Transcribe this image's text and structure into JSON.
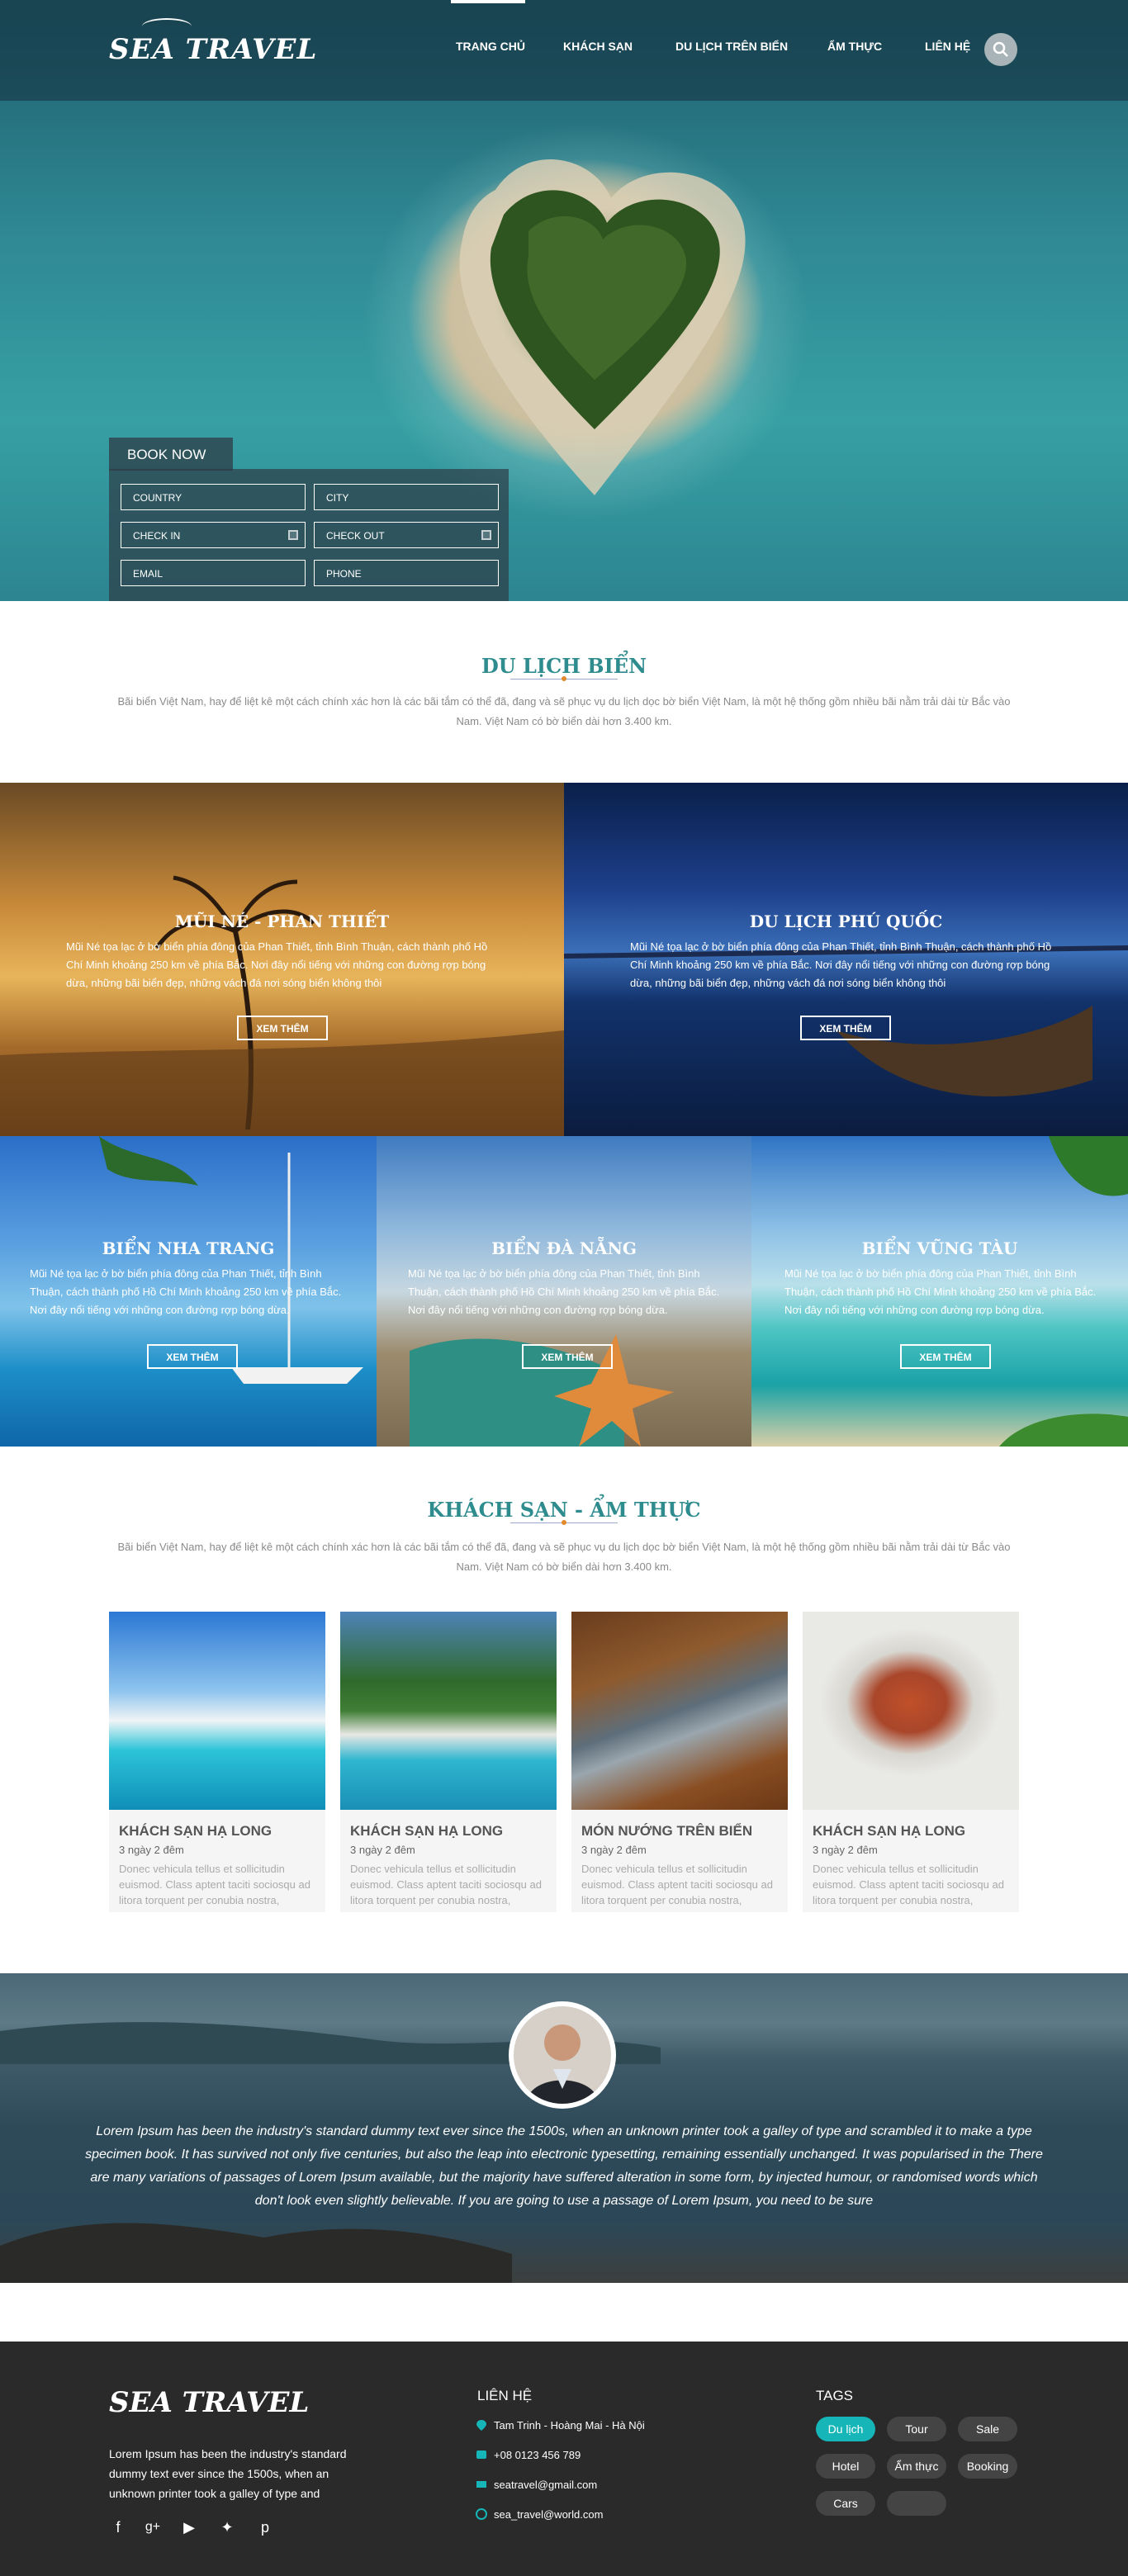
{
  "brand": {
    "logo": "SEA TRAVEL",
    "accent": "#2f8c8e",
    "tag_active": "#16b6b8"
  },
  "nav": {
    "items": [
      "TRANG CHỦ",
      "KHÁCH SẠN",
      "DU LỊCH TRÊN BIỂN",
      "ẨM THỰC",
      "LIÊN HỆ"
    ],
    "active": "TRANG CHỦ"
  },
  "booking": {
    "tab": "BOOK NOW",
    "fields": [
      "COUNTRY",
      "CITY",
      "CHECK IN",
      "CHECK OUT",
      "EMAIL",
      "PHONE"
    ]
  },
  "sea": {
    "title": "DU LỊCH BIỂN",
    "desc": "Bãi biển Việt Nam, hay để liệt kê một cách chính xác hơn là các bãi tắm có thể đã, đang và sẽ phục vụ du lịch dọc bờ biển Việt Nam, là một hệ thống gồm nhiều bãi nằm trải dài từ Bắc vào Nam. Việt Nam có bờ biển dài hơn 3.400 km."
  },
  "destinations": [
    {
      "title": "MŨI NÉ - PHAN THIẾT",
      "desc": "Mũi Né tọa lạc ở bờ biển phía đông của Phan Thiết, tỉnh Bình Thuận, cách thành phố Hồ Chí Minh khoảng 250 km về phía Bắc. Nơi đây nổi tiếng với những con đường rợp bóng dừa, những bãi biển đẹp, những vách đá nơi sóng biển không thôi",
      "button": "XEM THÊM"
    },
    {
      "title": "DU LỊCH PHÚ QUỐC",
      "desc": "Mũi Né tọa lạc ở bờ biển phía đông của Phan Thiết, tỉnh Bình Thuận, cách thành phố Hồ Chí Minh khoảng 250 km về phía Bắc. Nơi đây nổi tiếng với những con đường rợp bóng dừa, những bãi biển đẹp, những vách đá nơi sóng biển không thôi",
      "button": "XEM THÊM"
    },
    {
      "title": "BIỂN NHA TRANG",
      "desc": "Mũi Né tọa lạc ở bờ biển phía đông của Phan Thiết, tỉnh Bình Thuận, cách thành phố Hồ Chí Minh khoảng 250 km về phía Bắc. Nơi đây nổi tiếng với những con đường rợp bóng dừa.",
      "button": "XEM THÊM"
    },
    {
      "title": "BIỂN ĐÀ NẴNG",
      "desc": "Mũi Né tọa lạc ở bờ biển phía đông của Phan Thiết, tỉnh Bình Thuận, cách thành phố Hồ Chí Minh khoảng 250 km về phía Bắc. Nơi đây nổi tiếng với những con đường rợp bóng dừa.",
      "button": "XEM THÊM"
    },
    {
      "title": "BIỂN VŨNG TÀU",
      "desc": "Mũi Né tọa lạc ở bờ biển phía đông của Phan Thiết, tỉnh Bình Thuận, cách thành phố Hồ Chí Minh khoảng 250 km về phía Bắc. Nơi đây nổi tiếng với những con đường rợp bóng dừa.",
      "button": "XEM THÊM"
    }
  ],
  "hotels": {
    "title": "KHÁCH SẠN - ẨM THỰC",
    "desc": "Bãi biển Việt Nam, hay để liệt kê một cách chính xác hơn là các bãi tắm có thể đã, đang và sẽ phục vụ du lịch dọc bờ biển Việt Nam, là một hệ thống gồm nhiều bãi nằm trải dài từ Bắc vào Nam. Việt Nam có bờ biển dài hơn 3.400 km.",
    "cards": [
      {
        "title": "KHÁCH SẠN HẠ LONG",
        "duration": "3 ngày 2 đêm",
        "text": "Donec vehicula tellus et sollicitudin euismod. Class aptent taciti sociosqu ad litora torquent per conubia nostra,"
      },
      {
        "title": "KHÁCH SẠN HẠ LONG",
        "duration": "3 ngày 2 đêm",
        "text": "Donec vehicula tellus et sollicitudin euismod. Class aptent taciti sociosqu ad litora torquent per conubia nostra,"
      },
      {
        "title": "MÓN NƯỚNG TRÊN BIỂN",
        "duration": "3 ngày 2 đêm",
        "text": "Donec vehicula tellus et sollicitudin euismod. Class aptent taciti sociosqu ad litora torquent per conubia nostra,"
      },
      {
        "title": "KHÁCH SẠN HẠ LONG",
        "duration": "3 ngày 2 đêm",
        "text": "Donec vehicula tellus et sollicitudin euismod. Class aptent taciti sociosqu ad litora torquent per conubia nostra,"
      }
    ]
  },
  "testimonial": {
    "quote": "Lorem Ipsum has been the industry's standard dummy text ever since the 1500s, when an unknown printer took a galley of type and scrambled it to make a type specimen book. It has survived not only five centuries, but also the leap into electronic typesetting, remaining essentially unchanged. It was popularised in the There are many variations of passages of Lorem Ipsum available, but the majority have suffered alteration in some form, by injected humour, or randomised words which don't look even slightly believable. If you are going to use a passage of Lorem Ipsum, you need to be sure"
  },
  "footer": {
    "logo": "SEA TRAVEL",
    "about": "Lorem Ipsum has been the industry's standard dummy text ever since the 1500s, when an unknown printer took a galley of type and",
    "social": [
      "facebook-icon",
      "google-plus-icon",
      "youtube-icon",
      "twitter-icon",
      "pinterest-icon"
    ],
    "contact_title": "LIÊN HỆ",
    "contact": {
      "address": "Tam Trinh - Hoàng Mai - Hà Nội",
      "phone": "+08 0123 456 789",
      "email": "seatravel@gmail.com",
      "web": "sea_travel@world.com"
    },
    "tags_title": "TAGS",
    "tags": [
      "Du lịch",
      "Tour",
      "Sale",
      "Hotel",
      "Ẩm thực",
      "Booking",
      "Cars",
      ""
    ]
  }
}
